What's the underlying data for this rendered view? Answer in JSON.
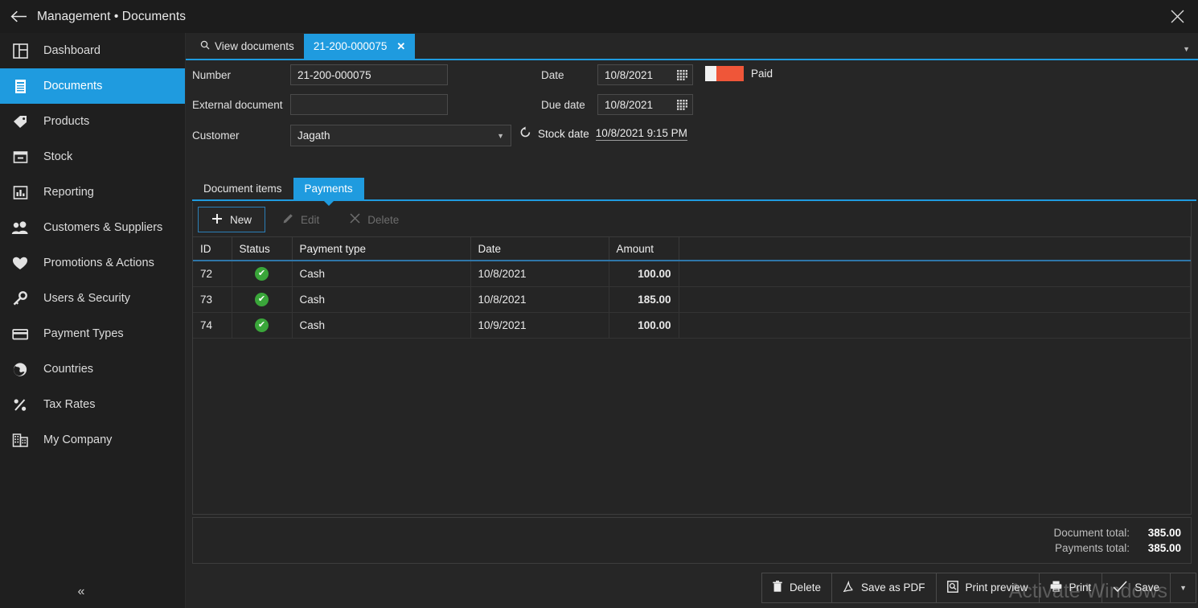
{
  "window": {
    "title": "Management • Documents",
    "back_icon": "back-arrow-icon",
    "close_icon": "close-icon"
  },
  "sidebar": {
    "collapse_icon": "«",
    "items": [
      {
        "label": "Dashboard",
        "icon": "dashboard-icon",
        "active": false
      },
      {
        "label": "Documents",
        "icon": "documents-icon",
        "active": true
      },
      {
        "label": "Products",
        "icon": "products-tag-icon",
        "active": false
      },
      {
        "label": "Stock",
        "icon": "stock-box-icon",
        "active": false
      },
      {
        "label": "Reporting",
        "icon": "reporting-chart-icon",
        "active": false
      },
      {
        "label": "Customers & Suppliers",
        "icon": "people-icon",
        "active": false
      },
      {
        "label": "Promotions & Actions",
        "icon": "heart-icon",
        "active": false
      },
      {
        "label": "Users & Security",
        "icon": "key-icon",
        "active": false
      },
      {
        "label": "Payment Types",
        "icon": "credit-card-icon",
        "active": false
      },
      {
        "label": "Countries",
        "icon": "globe-icon",
        "active": false
      },
      {
        "label": "Tax Rates",
        "icon": "percent-icon",
        "active": false
      },
      {
        "label": "My Company",
        "icon": "building-icon",
        "active": false
      }
    ]
  },
  "tabs": {
    "items": [
      {
        "label": "View documents",
        "icon": "search-icon",
        "active": false,
        "closable": false
      },
      {
        "label": "21-200-000075",
        "icon": "",
        "active": true,
        "closable": true,
        "close_label": "✕"
      }
    ],
    "overflow_icon": "chevron-down-icon"
  },
  "form": {
    "number_label": "Number",
    "number_value": "21-200-000075",
    "external_label": "External document",
    "external_value": "",
    "customer_label": "Customer",
    "customer_value": "Jagath",
    "date_label": "Date",
    "date_value": "10/8/2021",
    "due_date_label": "Due date",
    "due_date_value": "10/8/2021",
    "stock_date_label": "Stock date",
    "stock_date_value": "10/8/2021 9:15 PM",
    "stock_date_icon": "refresh-icon",
    "status_label": "Paid",
    "status_colors": {
      "left": "#f2f2f2",
      "right": "#ef5639"
    },
    "calendar_icon": "calendar-icon"
  },
  "inner_tabs": {
    "items": [
      {
        "label": "Document items",
        "active": false
      },
      {
        "label": "Payments",
        "active": true
      }
    ]
  },
  "commandbar": {
    "new_label": "New",
    "new_icon": "plus-icon",
    "edit_label": "Edit",
    "edit_icon": "pencil-icon",
    "edit_disabled": true,
    "delete_label": "Delete",
    "delete_icon": "x-icon",
    "delete_disabled": true
  },
  "grid": {
    "columns": [
      "ID",
      "Status",
      "Payment type",
      "Date",
      "Amount",
      ""
    ],
    "rows": [
      {
        "id": "72",
        "status": "ok",
        "payment_type": "Cash",
        "date": "10/8/2021",
        "amount": "100.00"
      },
      {
        "id": "73",
        "status": "ok",
        "payment_type": "Cash",
        "date": "10/8/2021",
        "amount": "185.00"
      },
      {
        "id": "74",
        "status": "ok",
        "payment_type": "Cash",
        "date": "10/9/2021",
        "amount": "100.00"
      }
    ],
    "status_icon": "check-circle-icon"
  },
  "totals": {
    "document_total_label": "Document total:",
    "document_total_value": "385.00",
    "payments_total_label": "Payments total:",
    "payments_total_value": "385.00"
  },
  "bottombar": {
    "buttons": [
      {
        "label": "Delete",
        "icon": "trash-icon"
      },
      {
        "label": "Save as PDF",
        "icon": "pdf-icon"
      },
      {
        "label": "Print preview",
        "icon": "print-preview-icon"
      },
      {
        "label": "Print",
        "icon": "printer-icon"
      },
      {
        "label": "Save",
        "icon": "check-icon"
      }
    ],
    "more_icon": "chevron-down-icon"
  },
  "watermark": {
    "text": "Activate Windows"
  },
  "theme": {
    "accent": "#1f9bdf",
    "window_bg": "#1c1c1c",
    "sidebar_bg": "#1f1f1f",
    "content_bg": "#262626",
    "status_green": "#3aa63a",
    "status_orange": "#ef5639"
  }
}
